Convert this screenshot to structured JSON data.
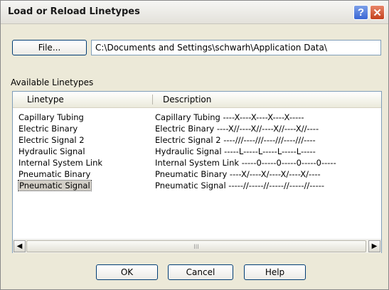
{
  "window": {
    "title": "Load or Reload Linetypes",
    "help_button": "?",
    "close_button": "✕"
  },
  "file": {
    "button_label": "File...",
    "path_value": "C:\\Documents and Settings\\schwarh\\Application Data\\"
  },
  "available_label": "Available Linetypes",
  "listview": {
    "columns": [
      "Linetype",
      "Description"
    ],
    "rows": [
      {
        "linetype": "Capillary Tubing",
        "description": "Capillary Tubing ----X----X----X----X-----"
      },
      {
        "linetype": "Electric Binary",
        "description": "Electric Binary ----X//----X//----X//----X//----"
      },
      {
        "linetype": "Electric Signal 2",
        "description": "Electric Signal 2 ----///----///----///----///----"
      },
      {
        "linetype": "Hydraulic Signal",
        "description": "Hydraulic Signal -----L-----L-----L-----L-----"
      },
      {
        "linetype": "Internal System Link",
        "description": "Internal System Link -----0-----0-----0-----0-----"
      },
      {
        "linetype": "Pneumatic Binary",
        "description": "Pneumatic Binary ----X/----X/----X/----X/----"
      },
      {
        "linetype": "Pneumatic Signal",
        "description": "Pneumatic Signal -----//-----//-----//-----//-----"
      }
    ],
    "selected_index": 6,
    "scroll_thumb_grip": "III"
  },
  "buttons": {
    "ok": "OK",
    "cancel": "Cancel",
    "help": "Help"
  }
}
